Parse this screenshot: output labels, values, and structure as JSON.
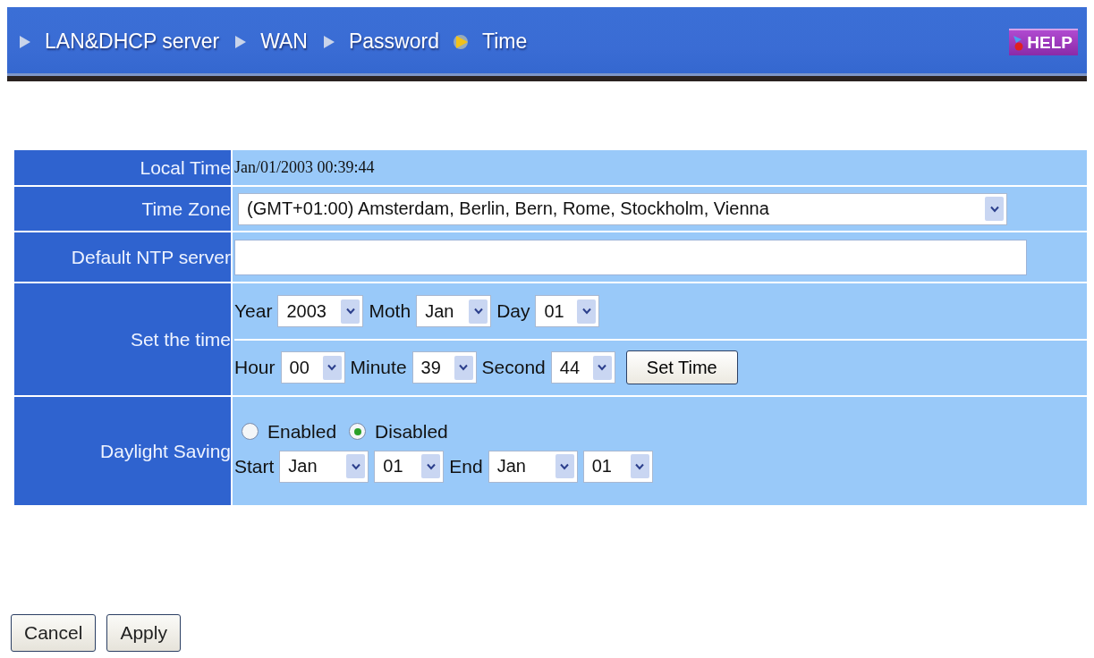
{
  "nav": {
    "items": [
      {
        "label": "LAN&DHCP server",
        "selected": false
      },
      {
        "label": "WAN",
        "selected": false
      },
      {
        "label": "Password",
        "selected": false
      },
      {
        "label": "Time",
        "selected": true
      }
    ],
    "help": "HELP"
  },
  "rows": [
    {
      "kind": "text",
      "label": "Local Time",
      "value": "Jan/01/2003 00:39:44"
    },
    {
      "kind": "select",
      "label": "Time Zone",
      "value": "(GMT+01:00) Amsterdam, Berlin, Bern, Rome, Stockholm, Vienna"
    },
    {
      "kind": "input",
      "label": "Default NTP server"
    },
    {
      "kind": "datetime",
      "label": "Set the time",
      "lines": [
        [
          {
            "label": "Year",
            "value": "2003"
          },
          {
            "label": "Moth",
            "value": "Jan"
          },
          {
            "label": "Day",
            "value": "01"
          }
        ],
        [
          {
            "label": "Hour",
            "value": "00"
          },
          {
            "label": "Minute",
            "value": "39"
          },
          {
            "label": "Second",
            "value": "44"
          }
        ]
      ],
      "button": "Set Time"
    },
    {
      "kind": "daylight",
      "label": "Daylight Saving",
      "options": [
        {
          "label": "Enabled",
          "selected": false
        },
        {
          "label": "Disabled",
          "selected": true
        }
      ],
      "ranges": [
        {
          "label": "Start",
          "month": "Jan",
          "day": "01"
        },
        {
          "label": "End",
          "month": "Jan",
          "day": "01"
        }
      ]
    }
  ],
  "buttons": [
    "Cancel",
    "Apply"
  ]
}
